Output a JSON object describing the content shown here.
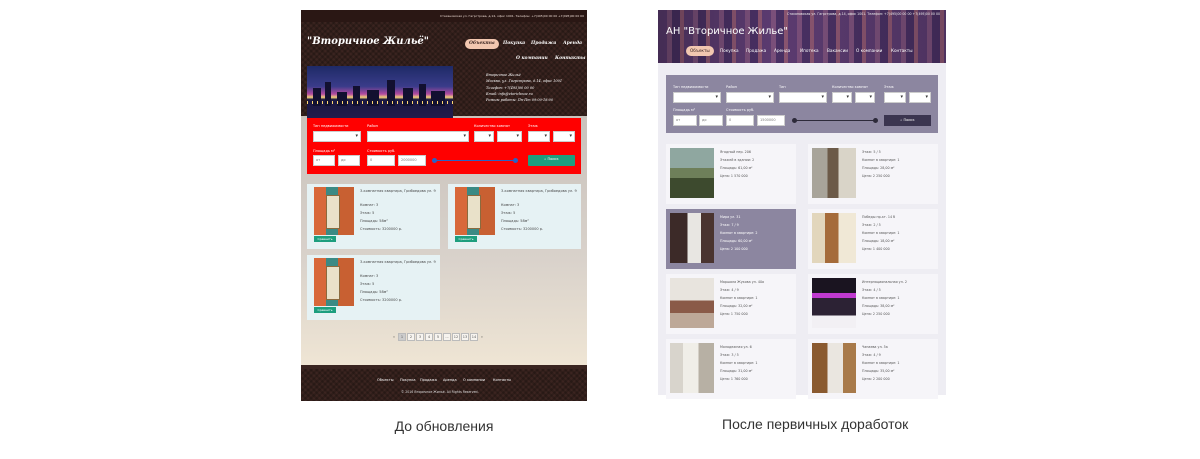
{
  "captions": {
    "before": "До обновления",
    "after": "После первичных доработок"
  },
  "before": {
    "top_strip": "Стахановская ул. Гагрстрова, д.14, офис 1001. Телефон: +7(495)00 00 00 +7(495)00 00 00",
    "logo": "\"Вторичное Жильё\"",
    "nav": [
      "Объекты",
      "Покупка",
      "Продажа",
      "Аренда"
    ],
    "nav2": [
      "О компании",
      "Контакты"
    ],
    "contacts": [
      "Вторичное Жильё",
      "Москва, ул. Гагрстрова, д.14, офис 1001",
      "Телефон: +7(495)00 00 00",
      "Email: info@vtorichnoe.ru",
      "Режим работы: Пн-Пт 09:00-18:00"
    ],
    "filter": {
      "labels": [
        "Тип недвижимости",
        "Район",
        "Количество комнат",
        "Этаж",
        "Площадь м²",
        "Стоимость руб."
      ],
      "area_from": "от",
      "area_to": "до",
      "price_from": "0",
      "price_to": "2000000",
      "search": "Поиск"
    },
    "cards": [
      {
        "title": "3-комнатная квартира, Грибоедова ул. 9",
        "rooms": "Комнат: 3",
        "floor": "Этаж: 5",
        "area": "Площадь: 58м²",
        "price": "Стоимость: 3200000 р.",
        "compare": "Сравнить"
      },
      {
        "title": "3-комнатная квартира, Грибоедова ул. 9",
        "rooms": "Комнат: 3",
        "floor": "Этаж: 5",
        "area": "Площадь: 58м²",
        "price": "Стоимость: 3200000 р.",
        "compare": "Сравнить"
      },
      {
        "title": "3-комнатная квартира, Грибоедова ул. 9",
        "rooms": "Комнат: 3",
        "floor": "Этаж: 5",
        "area": "Площадь: 58м²",
        "price": "Стоимость: 3200000 р.",
        "compare": "Сравнить"
      }
    ],
    "pager": [
      "1",
      "2",
      "3",
      "4",
      "5",
      "...",
      "12",
      "13",
      "14"
    ],
    "footer_nav": [
      "Объекты",
      "Покупка",
      "Продажа",
      "Аренда",
      "О компании",
      "Контакты"
    ],
    "copyright": "© 2016 Вторичное Жильё. All Rights Reserved."
  },
  "after": {
    "top_line": "Стахановская ул. Гагрстрова, д.14, офис 1001. Телефон: +7(495)00 00 00 +7(495)00 00 00",
    "logo": "АН \"Вторичное Жилье\"",
    "nav": [
      "Объекты",
      "Покупка",
      "Продажа",
      "Аренда",
      "Ипотека",
      "Вакансии",
      "О компании",
      "Контакты"
    ],
    "filter": {
      "labels": [
        "Тип недвижимости",
        "Район",
        "Тип",
        "Количество комнат",
        "Этаж",
        "Площадь м²",
        "Стоимость руб."
      ],
      "area_from": "от",
      "area_to": "до",
      "price_from": "0",
      "price_to": "1500000",
      "search": "Поиск"
    },
    "cards": [
      {
        "title": "Ягодный пер. 206",
        "l1": "Этажей в здании: 2",
        "l2": "Площадь: 61,00 м²",
        "l3": "Цена: 1 570 000"
      },
      {
        "title": "Этаж: 5 / 5",
        "l1": "Комнат в квартире: 1",
        "l2": "Площадь: 28,00 м²",
        "l3": "Цена: 2 250 000"
      },
      {
        "title": "Мира ул. 31",
        "l1": "Этаж: 7 / 9",
        "l2": "Комнат в квартире: 2",
        "l3": "Площадь: 60,00 м²",
        "l4": "Цена: 2 100 000"
      },
      {
        "title": "Победы пр-кт. 14 б",
        "l1": "Этаж: 2 / 5",
        "l2": "Комнат в квартире: 1",
        "l3": "Площадь: 18,00 м²",
        "l4": "Цена: 1 400 000"
      },
      {
        "title": "Маршала Жукова ул. 40а",
        "l1": "Этаж: 4 / 9",
        "l2": "Комнат в квартире: 1",
        "l3": "Площадь: 32,00 м²",
        "l4": "Цена: 1 750 000"
      },
      {
        "title": "Интернациональная ул. 2",
        "l1": "Этаж: 4 / 5",
        "l2": "Комнат в квартире: 1",
        "l3": "Площадь: 38,00 м²",
        "l4": "Цена: 2 250 000"
      },
      {
        "title": "Молодежная ул. 6",
        "l1": "Этаж: 3 / 5",
        "l2": "Комнат в квартире: 1",
        "l3": "Площадь: 31,00 м²",
        "l4": "Цена: 1 760 000"
      },
      {
        "title": "Чапаева ул. 5а",
        "l1": "Этаж: 4 / 9",
        "l2": "Комнат в квартире: 1",
        "l3": "Площадь: 35,00 м²",
        "l4": "Цена: 2 200 000"
      }
    ]
  }
}
